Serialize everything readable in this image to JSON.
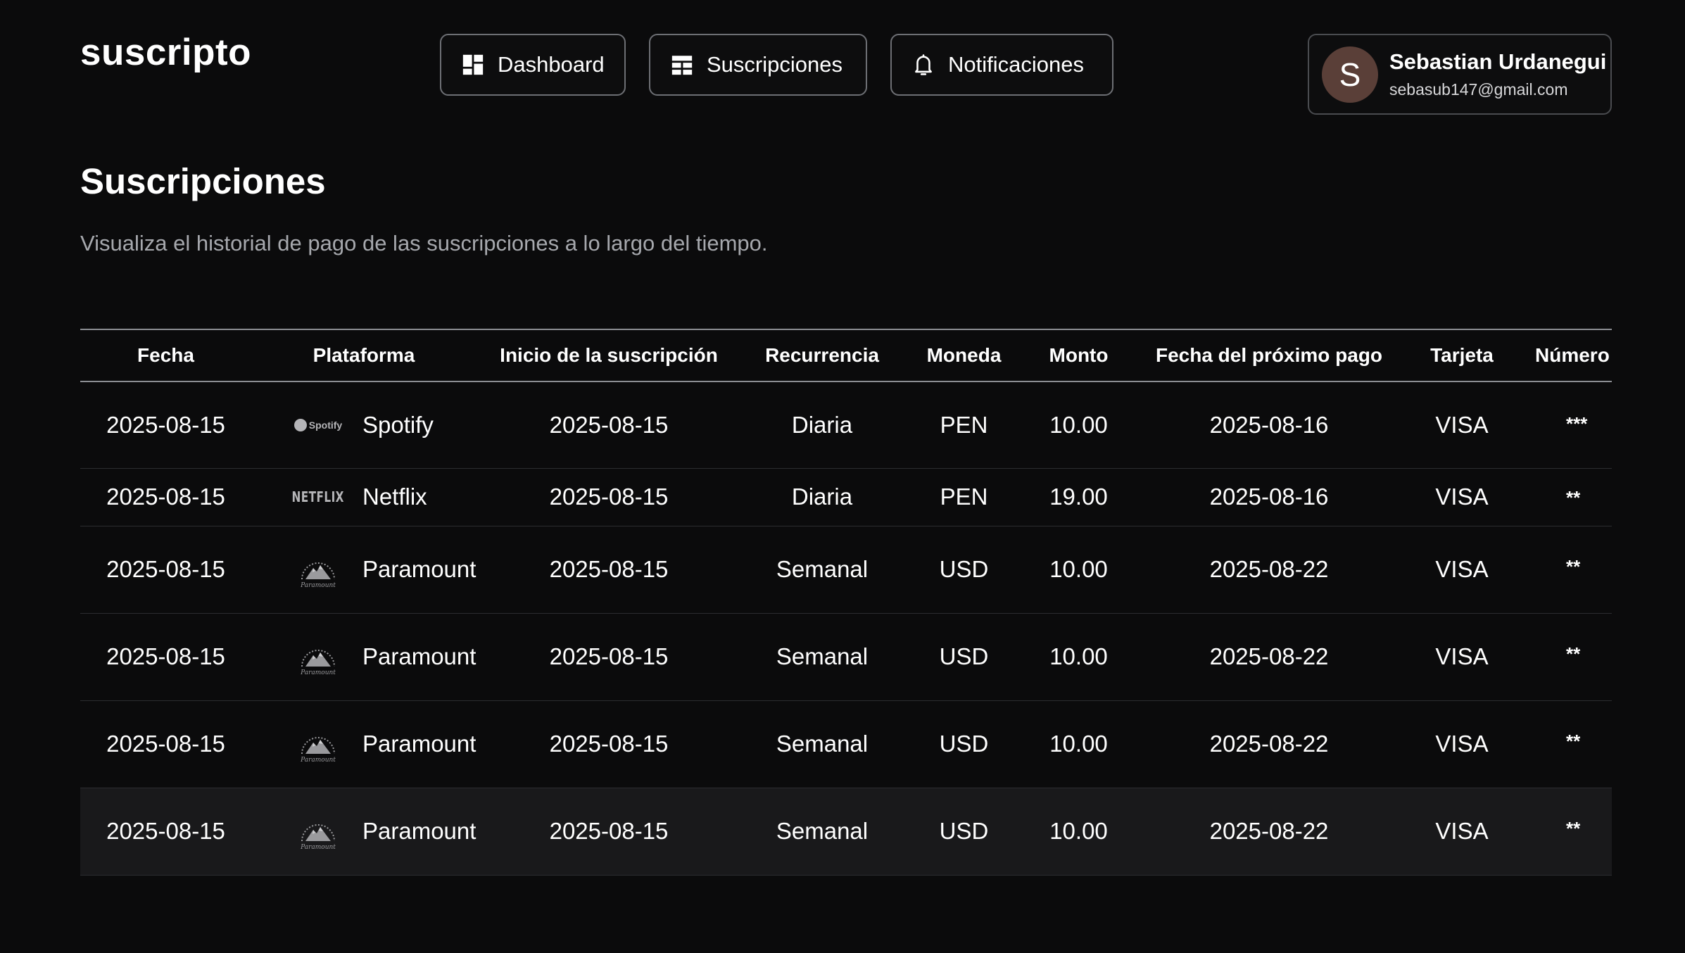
{
  "brand": "suscripto",
  "nav": {
    "dashboard": "Dashboard",
    "subscriptions": "Suscripciones",
    "notifications": "Notificaciones"
  },
  "user": {
    "initial": "S",
    "name": "Sebastian Urdanegui",
    "email": "sebasub147@gmail.com"
  },
  "page": {
    "title": "Suscripciones",
    "subtitle": "Visualiza el historial de pago de las suscripciones a lo largo del tiempo."
  },
  "table": {
    "headers": [
      "Fecha",
      "Plataforma",
      "Inicio de la suscripción",
      "Recurrencia",
      "Moneda",
      "Monto",
      "Fecha del próximo pago",
      "Tarjeta",
      "Número"
    ],
    "rows": [
      {
        "fecha": "2025-08-15",
        "plataforma": "Spotify",
        "logo_text": "Spotify",
        "inicio": "2025-08-15",
        "recurrencia": "Diaria",
        "moneda": "PEN",
        "monto": "10.00",
        "proximo": "2025-08-16",
        "tarjeta": "VISA",
        "numero": "***"
      },
      {
        "fecha": "2025-08-15",
        "plataforma": "Netflix",
        "logo_text": "NETFLIX",
        "inicio": "2025-08-15",
        "recurrencia": "Diaria",
        "moneda": "PEN",
        "monto": "19.00",
        "proximo": "2025-08-16",
        "tarjeta": "VISA",
        "numero": "**"
      },
      {
        "fecha": "2025-08-15",
        "plataforma": "Paramount",
        "logo_text": "Paramount",
        "inicio": "2025-08-15",
        "recurrencia": "Semanal",
        "moneda": "USD",
        "monto": "10.00",
        "proximo": "2025-08-22",
        "tarjeta": "VISA",
        "numero": "**"
      },
      {
        "fecha": "2025-08-15",
        "plataforma": "Paramount",
        "logo_text": "Paramount",
        "inicio": "2025-08-15",
        "recurrencia": "Semanal",
        "moneda": "USD",
        "monto": "10.00",
        "proximo": "2025-08-22",
        "tarjeta": "VISA",
        "numero": "**"
      },
      {
        "fecha": "2025-08-15",
        "plataforma": "Paramount",
        "logo_text": "Paramount",
        "inicio": "2025-08-15",
        "recurrencia": "Semanal",
        "moneda": "USD",
        "monto": "10.00",
        "proximo": "2025-08-22",
        "tarjeta": "VISA",
        "numero": "**"
      },
      {
        "fecha": "2025-08-15",
        "plataforma": "Paramount",
        "logo_text": "Paramount",
        "inicio": "2025-08-15",
        "recurrencia": "Semanal",
        "moneda": "USD",
        "monto": "10.00",
        "proximo": "2025-08-22",
        "tarjeta": "VISA",
        "numero": "**"
      }
    ]
  },
  "colors": {
    "background": "#0b0b0c",
    "text": "#ffffff",
    "muted": "#a6a8ad",
    "border": "#6d6f74",
    "avatar": "#5a3f38",
    "row_highlight": "#19191b"
  },
  "icons": {
    "dashboard": "dashboard-grid-icon",
    "subscriptions": "table-icon",
    "notifications": "bell-icon"
  }
}
